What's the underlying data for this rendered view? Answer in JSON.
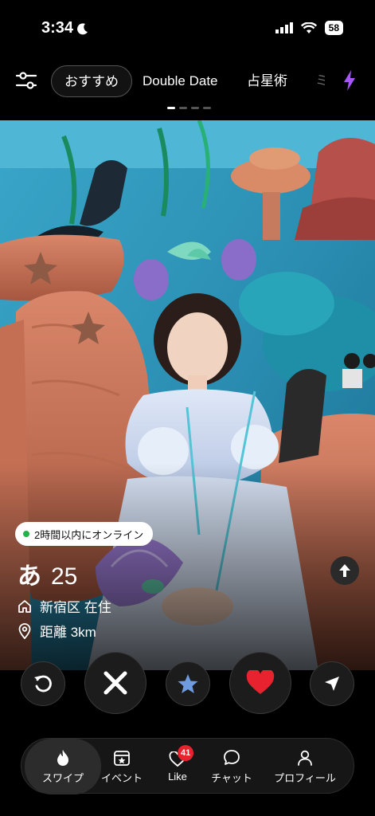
{
  "status_bar": {
    "time": "3:34",
    "battery": "58"
  },
  "top_nav": {
    "tabs": [
      {
        "label": "おすすめ",
        "active": true
      },
      {
        "label": "Double Date",
        "active": false
      },
      {
        "label": "占星術",
        "active": false
      },
      {
        "label": "ミ",
        "active": false
      }
    ]
  },
  "profile": {
    "online_status": "2時間以内にオンライン",
    "name": "あ",
    "age": "25",
    "residence": "新宿区 在住",
    "distance": "距離 3km"
  },
  "actions": [
    "rewind-icon",
    "close-icon",
    "star-icon",
    "heart-icon",
    "send-icon"
  ],
  "tabbar": {
    "items": [
      {
        "label": "スワイプ",
        "icon": "flame-icon",
        "active": true
      },
      {
        "label": "イベント",
        "icon": "event-icon",
        "active": false
      },
      {
        "label": "Like",
        "icon": "heart-outline-icon",
        "active": false,
        "badge": "41"
      },
      {
        "label": "チャット",
        "icon": "chat-icon",
        "active": false
      },
      {
        "label": "プロフィール",
        "icon": "person-icon",
        "active": false
      }
    ]
  },
  "colors": {
    "accent_bolt": "#a855f7",
    "like_red": "#e8232f",
    "star_blue": "#6f9be0",
    "online_green": "#26b04a"
  }
}
